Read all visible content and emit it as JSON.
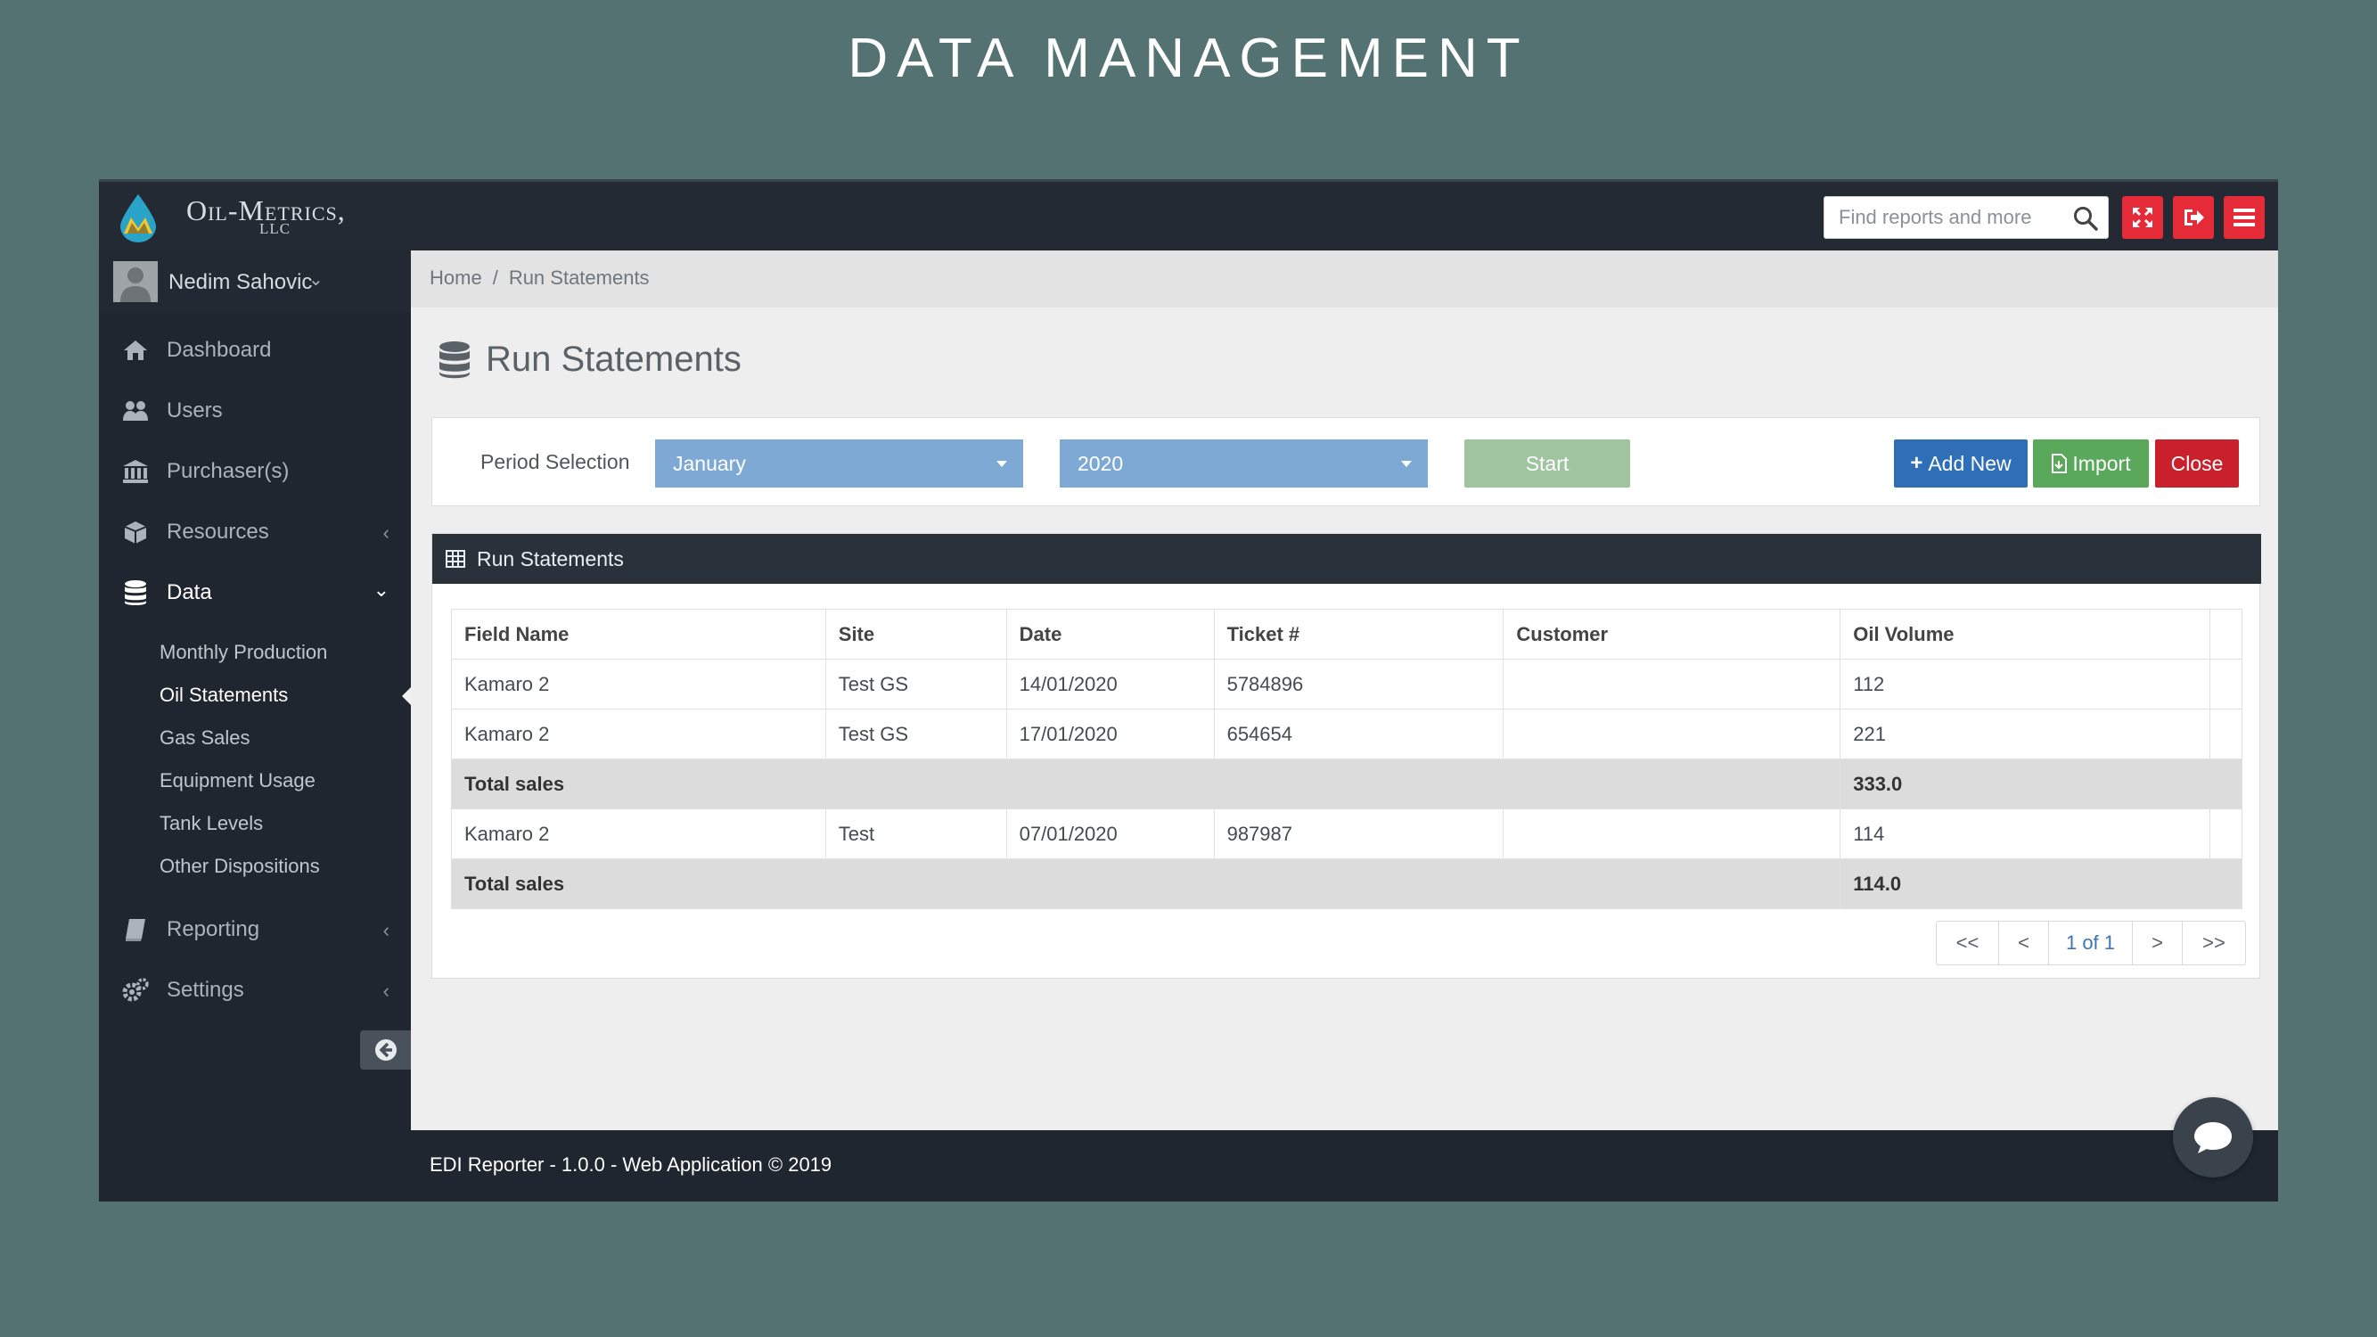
{
  "slide": {
    "title": "DATA MANAGEMENT"
  },
  "brand": {
    "name": "Oil-Metrics,",
    "suffix": "LLC"
  },
  "search": {
    "placeholder": "Find reports and more"
  },
  "topbar_buttons": [
    "expand-icon",
    "logout-icon",
    "menu-icon"
  ],
  "user": {
    "name": "Nedim Sahovic"
  },
  "sidebar": {
    "items": [
      {
        "label": "Dashboard",
        "icon": "home-icon"
      },
      {
        "label": "Users",
        "icon": "users-icon"
      },
      {
        "label": "Purchaser(s)",
        "icon": "bank-icon"
      },
      {
        "label": "Resources",
        "icon": "cube-icon"
      },
      {
        "label": "Data",
        "icon": "database-icon"
      },
      {
        "label": "Reporting",
        "icon": "book-icon"
      },
      {
        "label": "Settings",
        "icon": "gears-icon"
      }
    ],
    "data_submenu": [
      "Monthly Production",
      "Oil Statements",
      "Gas Sales",
      "Equipment Usage",
      "Tank Levels",
      "Other Dispositions"
    ],
    "active_submenu": "Oil Statements"
  },
  "breadcrumb": {
    "home": "Home",
    "sep": "/",
    "current": "Run Statements"
  },
  "page": {
    "title": "Run Statements"
  },
  "filters": {
    "label": "Period Selection",
    "month": "January",
    "year": "2020",
    "start": "Start",
    "add_new": "Add New",
    "import": "Import",
    "close": "Close"
  },
  "colors": {
    "accent_red": "#e52b38",
    "primary_blue": "#2e6fb7",
    "success_green": "#5aa85a",
    "danger_red": "#c9202b",
    "select_blue": "#7ea9d4"
  },
  "table": {
    "title": "Run Statements",
    "columns": [
      "Field Name",
      "Site",
      "Date",
      "Ticket #",
      "Customer",
      "Oil Volume"
    ],
    "rows": [
      {
        "type": "data",
        "cells": [
          "Kamaro 2",
          "Test GS",
          "14/01/2020",
          "5784896",
          "",
          "112"
        ]
      },
      {
        "type": "data",
        "cells": [
          "Kamaro 2",
          "Test GS",
          "17/01/2020",
          "654654",
          "",
          "221"
        ]
      },
      {
        "type": "total",
        "label": "Total sales",
        "value": "333.0"
      },
      {
        "type": "data",
        "cells": [
          "Kamaro 2",
          "Test",
          "07/01/2020",
          "987987",
          "",
          "114"
        ]
      },
      {
        "type": "total",
        "label": "Total sales",
        "value": "114.0"
      }
    ]
  },
  "pager": {
    "first": "<<",
    "prev": "<",
    "count": "1 of 1",
    "next": ">",
    "last": ">>"
  },
  "footer": {
    "text": "EDI Reporter - 1.0.0 - Web Application © 2019"
  }
}
